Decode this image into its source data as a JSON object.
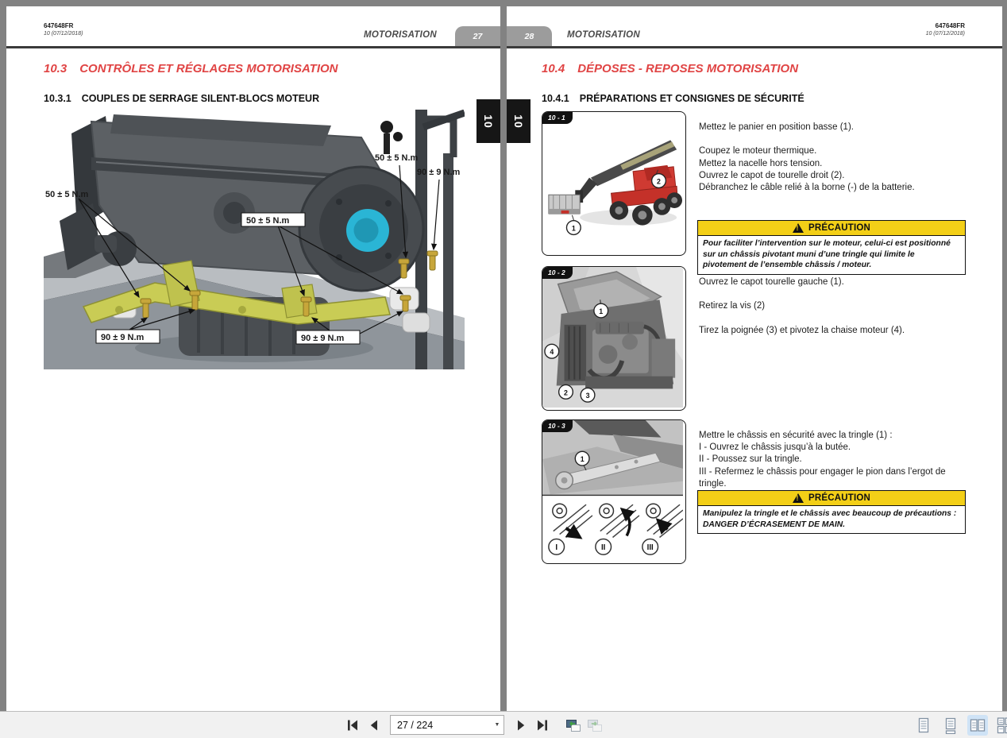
{
  "toolbar": {
    "page_indicator": "27 / 224"
  },
  "left_page": {
    "doc_ref": "647648FR",
    "revision": "10 (07/12/2018)",
    "running_header": "MOTORISATION",
    "page_number": "27",
    "chapter_tab": "10",
    "section_number": "10.3",
    "section_title": "CONTRÔLES ET RÉGLAGES MOTORISATION",
    "subsection_number": "10.3.1",
    "subsection_title": "COUPLES DE SERRAGE SILENT-BLOCS MOTEUR",
    "torque_labels": [
      "50 ± 5 N.m",
      "90 ± 9 N.m",
      "50 ± 5 N.m",
      "50 ± 5 N.m",
      "90 ± 9 N.m",
      "90 ± 9 N.m"
    ]
  },
  "right_page": {
    "doc_ref": "647648FR",
    "revision": "10 (07/12/2018)",
    "running_header": "MOTORISATION",
    "page_number": "28",
    "chapter_tab": "10",
    "section_number": "10.4",
    "section_title": "DÉPOSES - REPOSES MOTORISATION",
    "subsection_number": "10.4.1",
    "subsection_title": "PRÉPARATIONS ET CONSIGNES DE SÉCURITÉ",
    "figures": [
      {
        "id": "10 - 1",
        "callouts": [
          "1",
          "2"
        ]
      },
      {
        "id": "10 - 2",
        "callouts": [
          "1",
          "2",
          "3",
          "4"
        ]
      },
      {
        "id": "10 - 3",
        "callouts": [
          "1"
        ],
        "steps": [
          "I",
          "II",
          "III"
        ]
      }
    ],
    "step1_text": "Mettez le panier en position basse (1).\n\nCoupez le moteur thermique.\nMettez la nacelle hors tension.\nOuvrez le capot de tourelle droit (2).\nDébranchez le câble relié à la borne (-) de la batterie.",
    "caution1": {
      "title": "PRÉCAUTION",
      "body": "Pour faciliter l’intervention sur le moteur, celui-ci est positionné sur un châssis pivotant muni d’une tringle qui limite le pivotement de l’ensemble châssis / moteur."
    },
    "step2_text": "Ouvrez le capot tourelle gauche (1).\n\nRetirez la vis (2)\n\nTirez la poignée (3) et pivotez la chaise moteur (4).",
    "step3_text": "Mettre le châssis en sécurité avec la tringle (1) :\nI - Ouvrez le châssis jusqu’à la butée.\nII - Poussez sur la tringle.\nIII - Refermez le châssis pour engager le pion dans l’ergot de tringle.",
    "caution2": {
      "title": "PRÉCAUTION",
      "body": "Manipulez la tringle et le châssis avec beaucoup de précautions : DANGER D’ÉCRASEMENT DE MAIN."
    }
  },
  "colors": {
    "accent_red": "#e04444",
    "caution_yellow": "#f3cf17",
    "tab_gray": "#9c9c9c"
  }
}
